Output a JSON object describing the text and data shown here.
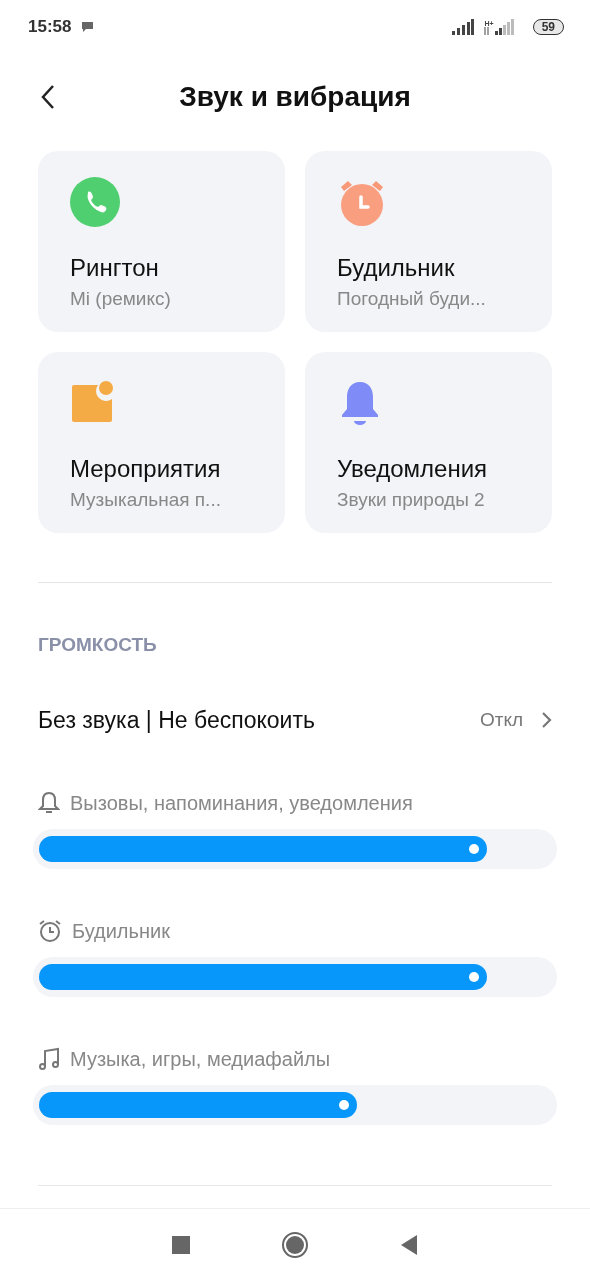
{
  "status_bar": {
    "time": "15:58",
    "network": "H+",
    "battery": "59"
  },
  "header": {
    "title": "Звук и вибрация"
  },
  "cards": [
    {
      "kind": "phone",
      "title": "Рингтон",
      "subtitle": "Mi (ремикс)"
    },
    {
      "kind": "alarm",
      "title": "Будильник",
      "subtitle": "Погодный буди..."
    },
    {
      "kind": "event",
      "title": "Мероприятия",
      "subtitle": "Музыкальная п..."
    },
    {
      "kind": "bell",
      "title": "Уведомления",
      "subtitle": "Звуки природы 2"
    }
  ],
  "volume": {
    "heading": "ГРОМКОСТЬ",
    "dnd": {
      "label": "Без звука | Не беспокоить",
      "value": "Откл"
    },
    "sliders": [
      {
        "kind": "bell",
        "label": "Вызовы, напоминания, уведомления",
        "level": 0.842
      },
      {
        "kind": "alarm",
        "label": "Будильник",
        "level": 0.842
      },
      {
        "kind": "music",
        "label": "Музыка, игры, медиафайлы",
        "level": 0.594
      }
    ]
  }
}
